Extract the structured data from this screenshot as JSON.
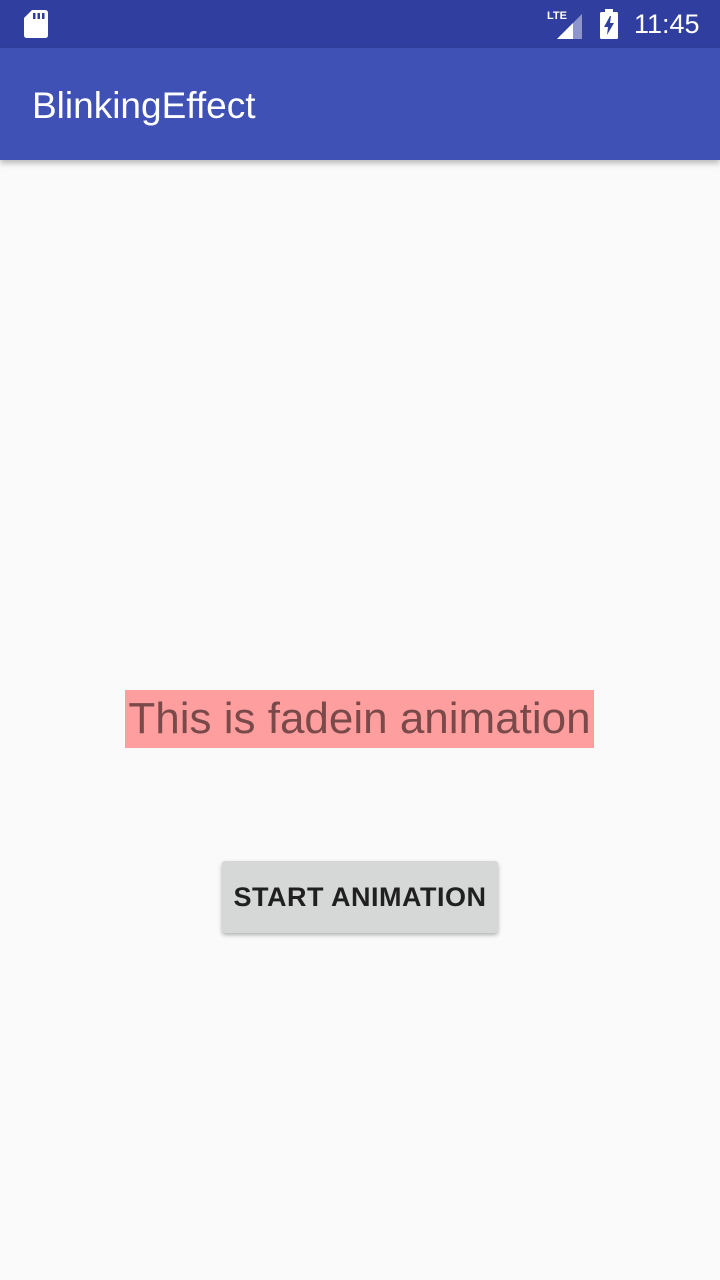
{
  "status_bar": {
    "time": "11:45",
    "network_label": "LTE",
    "icons": [
      "sd-card-icon",
      "lte-signal-icon",
      "battery-charging-icon"
    ]
  },
  "app_bar": {
    "title": "BlinkingEffect"
  },
  "main": {
    "animated_text": "This is fadein animation",
    "start_button_label": "START ANIMATION"
  },
  "colors": {
    "status_bar": "#303f9f",
    "app_bar": "#3f51b5",
    "background": "#fafafa",
    "text_highlight": "#ff9e9e",
    "text_color": "#7a4a4a",
    "button_background": "#d6d7d7"
  }
}
